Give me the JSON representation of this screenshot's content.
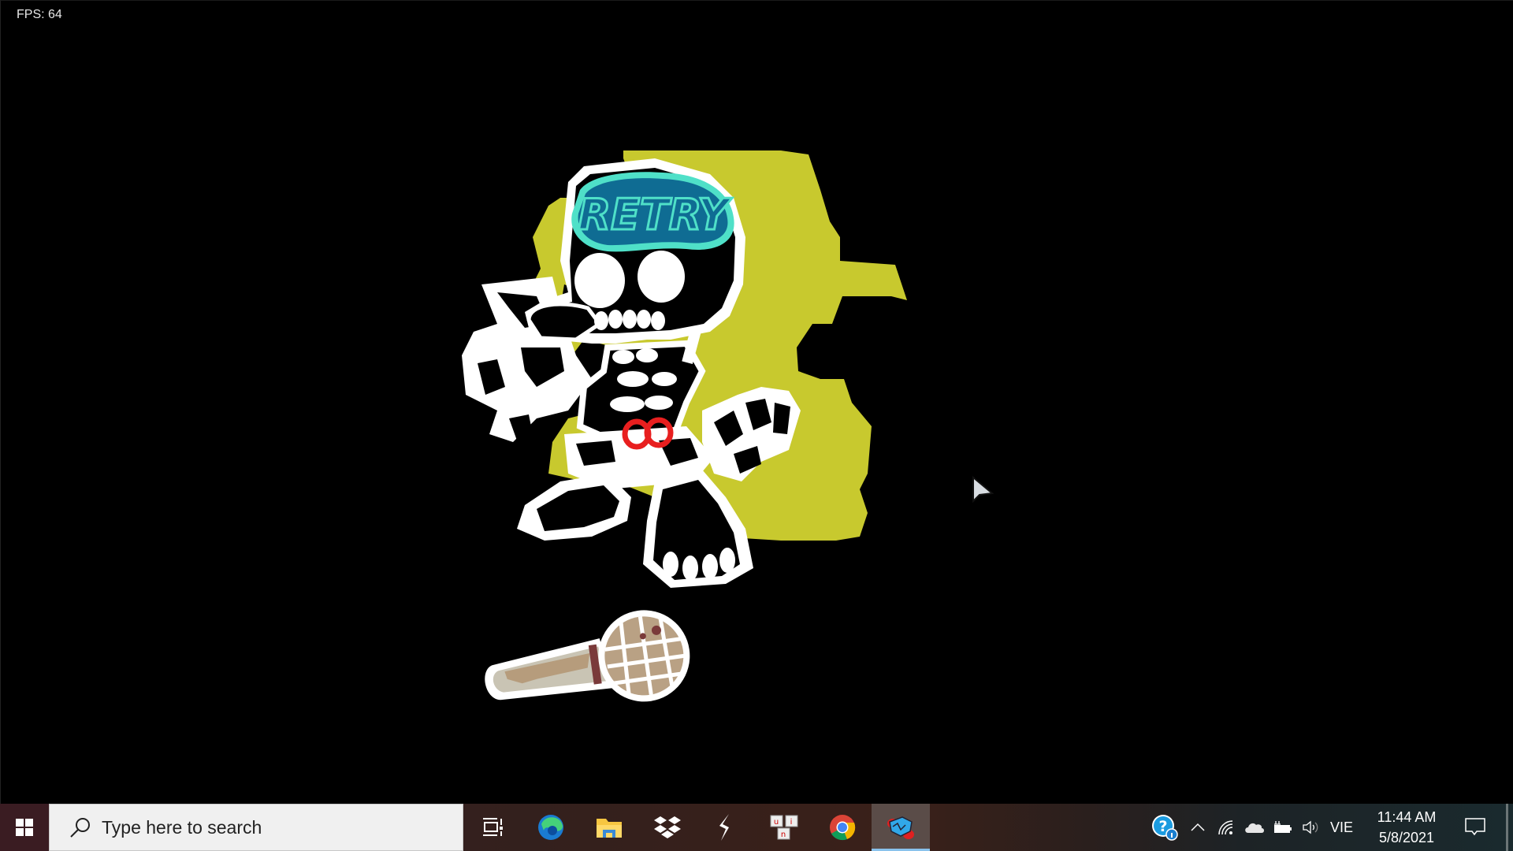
{
  "game": {
    "fps_label": "FPS: 64",
    "screen": "game-over",
    "logo_text": "RETRY",
    "colors": {
      "background": "#000000",
      "outline_glow": "#c8c92e",
      "brain": "#0f6c93",
      "brain_outline": "#4fe0c8",
      "bowtie": "#e81f1f",
      "bone": "#ffffff"
    }
  },
  "taskbar": {
    "start_label": "Start",
    "search_placeholder": "Type here to search",
    "pinned": [
      {
        "name": "Task View",
        "icon": "task-view-icon"
      },
      {
        "name": "Microsoft Edge",
        "icon": "edge-icon"
      },
      {
        "name": "File Explorer",
        "icon": "file-explorer-icon"
      },
      {
        "name": "Dropbox",
        "icon": "dropbox-icon"
      },
      {
        "name": "Stylus app",
        "icon": "stylus-icon"
      },
      {
        "name": "Unikey",
        "icon": "unikey-icon"
      },
      {
        "name": "Google Chrome",
        "icon": "chrome-icon"
      },
      {
        "name": "Friday Night Funkin'",
        "icon": "fnf-icon",
        "active": true
      }
    ],
    "tray": {
      "help_icon": "help-info-icon",
      "overflow_icon": "chevron-up-icon",
      "network_icon": "wifi-icon",
      "onedrive_icon": "onedrive-icon",
      "battery_icon": "battery-charging-icon",
      "volume_icon": "volume-icon",
      "language": "VIE",
      "time": "11:44 AM",
      "date": "5/8/2021",
      "notifications_icon": "action-center-icon"
    }
  }
}
